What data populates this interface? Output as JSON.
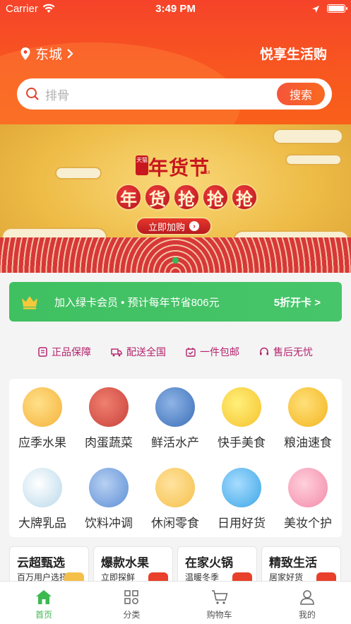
{
  "status_bar": {
    "carrier": "Carrier",
    "time": "3:49 PM"
  },
  "header": {
    "city": "东城",
    "title": "悦享生活购"
  },
  "search": {
    "placeholder": "排骨",
    "button": "搜索"
  },
  "banner": {
    "tmall": "天猫",
    "title": "年货节",
    "year": "2018",
    "chars": [
      "年",
      "货",
      "抢",
      "抢",
      "抢"
    ],
    "cta": "立即加购",
    "active_index": 0
  },
  "member": {
    "text": "加入绿卡会员 • 预计每年节省806元",
    "cta": "5折开卡 >"
  },
  "guarantees": [
    "正品保障",
    "配送全国",
    "一件包邮",
    "售后无忧"
  ],
  "categories": [
    {
      "label": "应季水果",
      "color": "#f5b23a"
    },
    {
      "label": "肉蛋蔬菜",
      "color": "#c8403a"
    },
    {
      "label": "鲜活水产",
      "color": "#3a6fb8"
    },
    {
      "label": "快手美食",
      "color": "#f6c22e"
    },
    {
      "label": "粮油速食",
      "color": "#f3b51e"
    },
    {
      "label": "大牌乳品",
      "color": "#d9ecf5"
    },
    {
      "label": "饮料冲调",
      "color": "#5c8fd6"
    },
    {
      "label": "休闲零食",
      "color": "#f5c04a"
    },
    {
      "label": "日用好货",
      "color": "#3ba6e6"
    },
    {
      "label": "美妆个护",
      "color": "#f28aa8"
    }
  ],
  "promos": [
    {
      "title": "云超甄选",
      "subtitle": "百万用户选择"
    },
    {
      "title": "爆款水果",
      "subtitle": "立即探鲜"
    },
    {
      "title": "在家火锅",
      "subtitle": "温暖冬季"
    },
    {
      "title": "精致生活",
      "subtitle": "居家好货"
    }
  ],
  "tabbar": [
    {
      "label": "首页",
      "icon": "home-icon",
      "active": true
    },
    {
      "label": "分类",
      "icon": "category-icon",
      "active": false
    },
    {
      "label": "购物车",
      "icon": "cart-icon",
      "active": false
    },
    {
      "label": "我的",
      "icon": "profile-icon",
      "active": false
    }
  ],
  "colors": {
    "brand": "#f6432a",
    "green": "#3fc061",
    "guarantee": "#b4236d"
  }
}
